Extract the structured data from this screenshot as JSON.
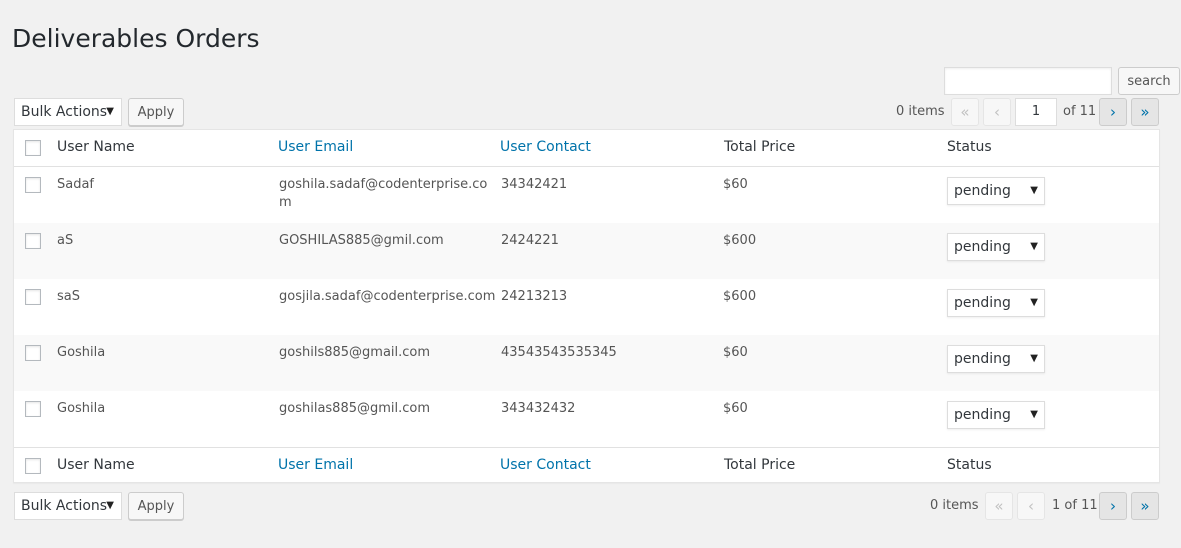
{
  "page": {
    "title": "Deliverables Orders"
  },
  "search": {
    "value": "",
    "button_label": "search"
  },
  "tablenav": {
    "bulk_label": "Bulk Actions",
    "apply_label": "Apply",
    "items_text": "0 items",
    "first_symbol": "«",
    "prev_symbol": "‹",
    "next_symbol": "›",
    "last_symbol": "»",
    "current_page": "1",
    "of_total": "of 11",
    "bottom_pages": "1 of 11"
  },
  "columns": {
    "name": "User Name",
    "email": "User Email",
    "contact": "User Contact",
    "price": "Total Price",
    "status": "Status"
  },
  "rows": [
    {
      "name": "Sadaf",
      "email": "goshila.sadaf@codenterprise.co",
      "email2": "m",
      "contact": "34342421",
      "price": "$60",
      "status": "pending"
    },
    {
      "name": "aS",
      "email": "GOSHILAS885@gmil.com",
      "email2": "",
      "contact": "2424221",
      "price": "$600",
      "status": "pending"
    },
    {
      "name": "saS",
      "email": "gosjila.sadaf@codenterprise.com",
      "email2": "",
      "contact": "24213213",
      "price": "$600",
      "status": "pending"
    },
    {
      "name": "Goshila",
      "email": "goshils885@gmail.com",
      "email2": "",
      "contact": "43543543535345",
      "price": "$60",
      "status": "pending"
    },
    {
      "name": "Goshila",
      "email": "goshilas885@gmil.com",
      "email2": "",
      "contact": "343432432",
      "price": "$60",
      "status": "pending"
    }
  ],
  "icons": {
    "dropdown_caret": "▼"
  },
  "colors": {
    "link": "#0073aa",
    "background": "#f1f1f1",
    "text": "#555555"
  }
}
